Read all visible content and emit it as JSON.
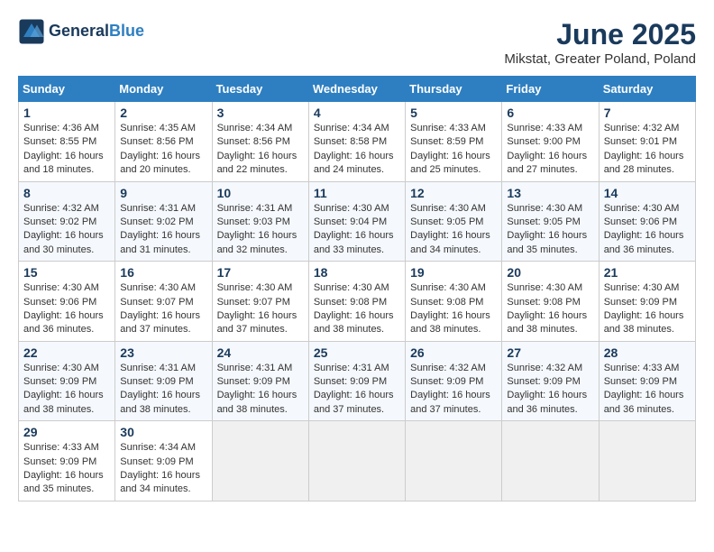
{
  "header": {
    "logo_line1": "General",
    "logo_line2": "Blue",
    "month_year": "June 2025",
    "location": "Mikstat, Greater Poland, Poland"
  },
  "days_of_week": [
    "Sunday",
    "Monday",
    "Tuesday",
    "Wednesday",
    "Thursday",
    "Friday",
    "Saturday"
  ],
  "weeks": [
    [
      {
        "day": "1",
        "sunrise": "4:36 AM",
        "sunset": "8:55 PM",
        "daylight": "16 hours and 18 minutes."
      },
      {
        "day": "2",
        "sunrise": "4:35 AM",
        "sunset": "8:56 PM",
        "daylight": "16 hours and 20 minutes."
      },
      {
        "day": "3",
        "sunrise": "4:34 AM",
        "sunset": "8:56 PM",
        "daylight": "16 hours and 22 minutes."
      },
      {
        "day": "4",
        "sunrise": "4:34 AM",
        "sunset": "8:58 PM",
        "daylight": "16 hours and 24 minutes."
      },
      {
        "day": "5",
        "sunrise": "4:33 AM",
        "sunset": "8:59 PM",
        "daylight": "16 hours and 25 minutes."
      },
      {
        "day": "6",
        "sunrise": "4:33 AM",
        "sunset": "9:00 PM",
        "daylight": "16 hours and 27 minutes."
      },
      {
        "day": "7",
        "sunrise": "4:32 AM",
        "sunset": "9:01 PM",
        "daylight": "16 hours and 28 minutes."
      }
    ],
    [
      {
        "day": "8",
        "sunrise": "4:32 AM",
        "sunset": "9:02 PM",
        "daylight": "16 hours and 30 minutes."
      },
      {
        "day": "9",
        "sunrise": "4:31 AM",
        "sunset": "9:02 PM",
        "daylight": "16 hours and 31 minutes."
      },
      {
        "day": "10",
        "sunrise": "4:31 AM",
        "sunset": "9:03 PM",
        "daylight": "16 hours and 32 minutes."
      },
      {
        "day": "11",
        "sunrise": "4:30 AM",
        "sunset": "9:04 PM",
        "daylight": "16 hours and 33 minutes."
      },
      {
        "day": "12",
        "sunrise": "4:30 AM",
        "sunset": "9:05 PM",
        "daylight": "16 hours and 34 minutes."
      },
      {
        "day": "13",
        "sunrise": "4:30 AM",
        "sunset": "9:05 PM",
        "daylight": "16 hours and 35 minutes."
      },
      {
        "day": "14",
        "sunrise": "4:30 AM",
        "sunset": "9:06 PM",
        "daylight": "16 hours and 36 minutes."
      }
    ],
    [
      {
        "day": "15",
        "sunrise": "4:30 AM",
        "sunset": "9:06 PM",
        "daylight": "16 hours and 36 minutes."
      },
      {
        "day": "16",
        "sunrise": "4:30 AM",
        "sunset": "9:07 PM",
        "daylight": "16 hours and 37 minutes."
      },
      {
        "day": "17",
        "sunrise": "4:30 AM",
        "sunset": "9:07 PM",
        "daylight": "16 hours and 37 minutes."
      },
      {
        "day": "18",
        "sunrise": "4:30 AM",
        "sunset": "9:08 PM",
        "daylight": "16 hours and 38 minutes."
      },
      {
        "day": "19",
        "sunrise": "4:30 AM",
        "sunset": "9:08 PM",
        "daylight": "16 hours and 38 minutes."
      },
      {
        "day": "20",
        "sunrise": "4:30 AM",
        "sunset": "9:08 PM",
        "daylight": "16 hours and 38 minutes."
      },
      {
        "day": "21",
        "sunrise": "4:30 AM",
        "sunset": "9:09 PM",
        "daylight": "16 hours and 38 minutes."
      }
    ],
    [
      {
        "day": "22",
        "sunrise": "4:30 AM",
        "sunset": "9:09 PM",
        "daylight": "16 hours and 38 minutes."
      },
      {
        "day": "23",
        "sunrise": "4:31 AM",
        "sunset": "9:09 PM",
        "daylight": "16 hours and 38 minutes."
      },
      {
        "day": "24",
        "sunrise": "4:31 AM",
        "sunset": "9:09 PM",
        "daylight": "16 hours and 38 minutes."
      },
      {
        "day": "25",
        "sunrise": "4:31 AM",
        "sunset": "9:09 PM",
        "daylight": "16 hours and 37 minutes."
      },
      {
        "day": "26",
        "sunrise": "4:32 AM",
        "sunset": "9:09 PM",
        "daylight": "16 hours and 37 minutes."
      },
      {
        "day": "27",
        "sunrise": "4:32 AM",
        "sunset": "9:09 PM",
        "daylight": "16 hours and 36 minutes."
      },
      {
        "day": "28",
        "sunrise": "4:33 AM",
        "sunset": "9:09 PM",
        "daylight": "16 hours and 36 minutes."
      }
    ],
    [
      {
        "day": "29",
        "sunrise": "4:33 AM",
        "sunset": "9:09 PM",
        "daylight": "16 hours and 35 minutes."
      },
      {
        "day": "30",
        "sunrise": "4:34 AM",
        "sunset": "9:09 PM",
        "daylight": "16 hours and 34 minutes."
      },
      null,
      null,
      null,
      null,
      null
    ]
  ]
}
